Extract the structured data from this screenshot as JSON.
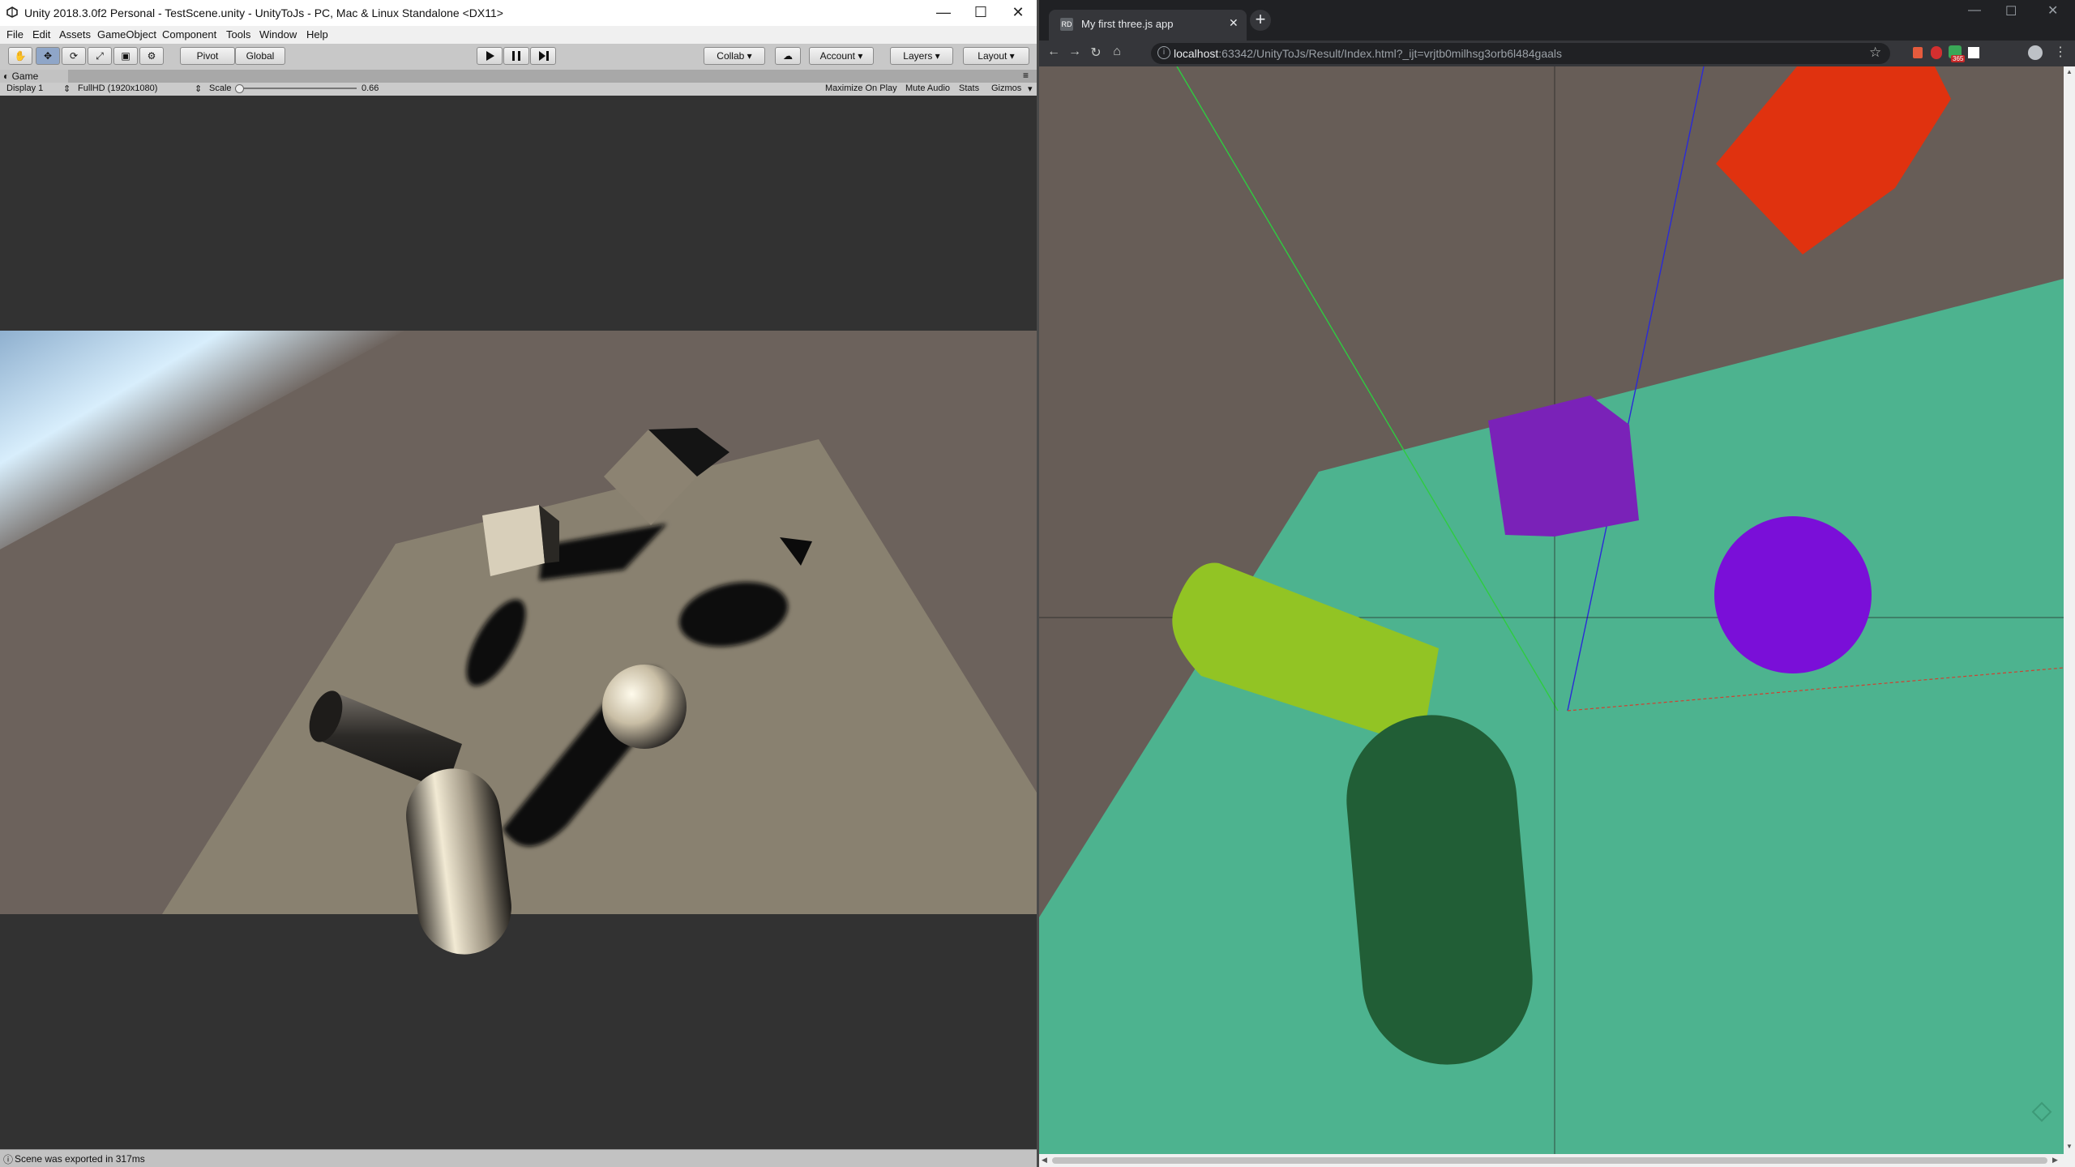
{
  "unity": {
    "window_title": "Unity 2018.3.0f2 Personal - TestScene.unity - UnityToJs - PC, Mac & Linux Standalone <DX11>",
    "menu": [
      "File",
      "Edit",
      "Assets",
      "GameObject",
      "Component",
      "Tools",
      "Window",
      "Help"
    ],
    "toolbar": {
      "pivot": "Pivot",
      "global": "Global",
      "collab": "Collab",
      "account": "Account",
      "layers": "Layers",
      "layout": "Layout"
    },
    "game_tab": "Game",
    "game_bar": {
      "display": "Display 1",
      "resolution": "FullHD (1920x1080)",
      "scale_label": "Scale",
      "scale_value": "0.66",
      "maximize": "Maximize On Play",
      "mute": "Mute Audio",
      "stats": "Stats",
      "gizmos": "Gizmos"
    },
    "status": "Scene was exported in 317ms"
  },
  "browser": {
    "tab_title": "My first three.js app",
    "url_host": "localhost",
    "url_rest": ":63342/UnityToJs/Result/Index.html?_ijt=vrjtb0milhsg3orb6l484gaals",
    "extension_badge": "365"
  }
}
